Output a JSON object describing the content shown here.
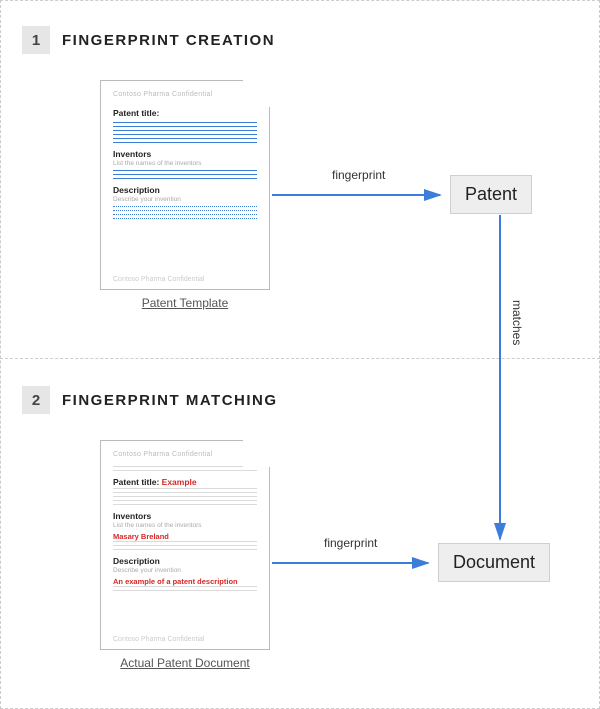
{
  "sections": {
    "one": {
      "num": "1",
      "title": "FINGERPRINT CREATION"
    },
    "two": {
      "num": "2",
      "title": "FINGERPRINT MATCHING"
    }
  },
  "template_doc": {
    "header": "Contoso Pharma Confidential",
    "title_label": "Patent title:",
    "inventors_label": "Inventors",
    "inventors_sub": "List the names of the inventors",
    "description_label": "Description",
    "description_sub": "Describe your invention",
    "footer": "Contoso Pharma Confidential",
    "caption": "Patent Template"
  },
  "actual_doc": {
    "header": "Contoso Pharma Confidential",
    "title_label": "Patent title:",
    "title_value": "Example",
    "inventors_label": "Inventors",
    "inventors_sub": "List the names of the inventors",
    "inventors_value": "Masary Breland",
    "description_label": "Description",
    "description_sub": "Describe your invention",
    "description_value": "An example of a patent description",
    "footer": "Contoso Pharma Confidential",
    "caption": "Actual Patent Document"
  },
  "nodes": {
    "patent": "Patent",
    "document": "Document"
  },
  "arrows": {
    "fingerprint1": "fingerprint",
    "matches": "matches",
    "fingerprint2": "fingerprint"
  }
}
